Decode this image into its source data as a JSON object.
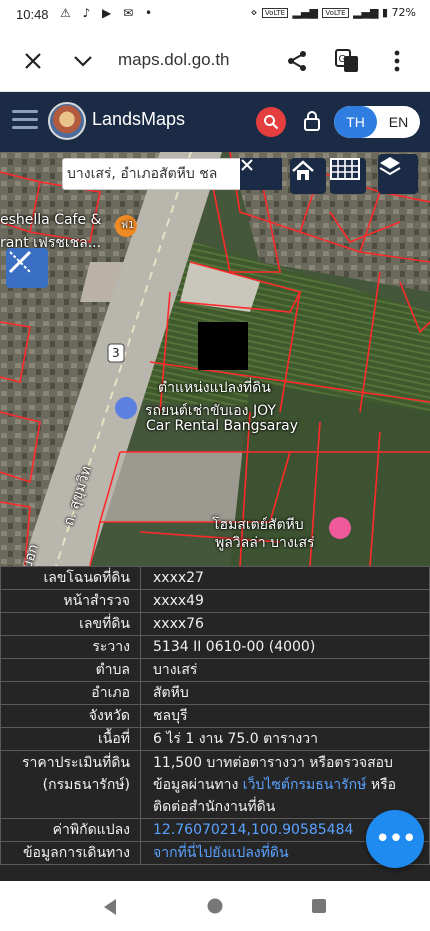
{
  "status_bar": {
    "time": "10:48",
    "battery": "72%",
    "network_badge": "VoLTE"
  },
  "browser": {
    "url": "maps.dol.go.th"
  },
  "app": {
    "brand": "LandsMaps",
    "lang_th": "TH",
    "lang_en": "EN"
  },
  "map": {
    "search_value": "บางเสร่, อำเภอสัตหีบ ชล",
    "labels": {
      "cafe": "eshella Cafe &",
      "cafe2": "rant เฟรชเชล...",
      "route": "3",
      "parcel": "ตำแหน่งแปลงที่ดิน",
      "car_rental_th": "รถยนต์เช่าขับเอง JOY",
      "car_rental_en": "Car Rental Bangsaray",
      "homestay1": "โฮมสเตย์สัตหีบ",
      "homestay2": "พูลวิลล่า บางเสร่",
      "road": "ถ. สุขุมวิท",
      "road2": "บอก",
      "fuel": "ฟ1"
    }
  },
  "info": {
    "rows": [
      {
        "key": "เลขโฉนดที่ดิน",
        "value": "xxxx27"
      },
      {
        "key": "หน้าสำรวจ",
        "value": "xxxx49"
      },
      {
        "key": "เลขที่ดิน",
        "value": "xxxx76"
      },
      {
        "key": "ระวาง",
        "value": "5134 II 0610-00 (4000)"
      },
      {
        "key": "ตำบล",
        "value": "บางเสร่"
      },
      {
        "key": "อำเภอ",
        "value": "สัตหีบ"
      },
      {
        "key": "จังหวัด",
        "value": "ชลบุรี"
      },
      {
        "key": "เนื้อที่",
        "value": "6 ไร่ 1 งาน 75.0 ตารางวา"
      }
    ],
    "price": {
      "key1": "ราคาประเมินที่ดิน",
      "key2": "(กรมธนารักษ์)",
      "line1": "11,500 บาทต่อตารางวา หรือตรวจสอบ",
      "line2_pre": "ข้อมูลผ่านทาง ",
      "line2_link": "เว็บไซต์กรมธนารักษ์",
      "line2_post": " หรือ",
      "line3": "ติดต่อสำนักงานที่ดิน"
    },
    "coords": {
      "key": "ค่าพิกัดแปลง",
      "value": "12.76070214,100.90585484"
    },
    "directions": {
      "key": "ข้อมูลการเดินทาง",
      "value": "จากที่นี่ไปยังแปลงที่ดิน"
    }
  },
  "fab": {
    "label": "•••"
  },
  "colors": {
    "header": "#1b2b45",
    "accent_red": "#e53e3e",
    "toggle_blue": "#2f7de1",
    "link": "#5aa2ff",
    "fab": "#1f8bf0",
    "parcel_line": "#ff2a2a"
  }
}
